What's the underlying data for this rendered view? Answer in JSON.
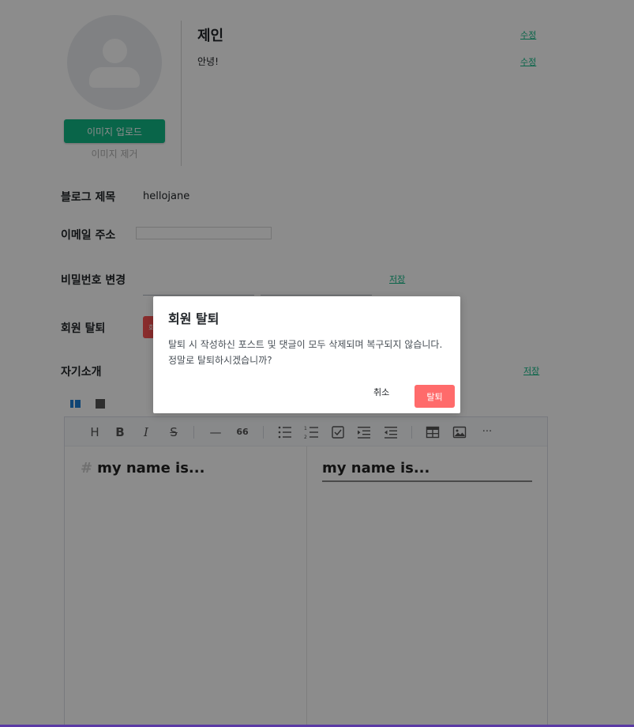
{
  "profile": {
    "name": "제인",
    "description": "안녕!",
    "edit_name_label": "수정",
    "edit_desc_label": "수정",
    "upload_label": "이미지 업로드",
    "remove_label": "이미지 제거"
  },
  "settings": {
    "blog_title_label": "블로그 제목",
    "blog_title_value": "hellojane",
    "email_label": "이메일 주소",
    "email_value": "",
    "password_label": "비밀번호 변경",
    "password_save_label": "저장",
    "withdraw_label": "회원 탈퇴",
    "withdraw_button_label": "회",
    "bio_label": "자기소개",
    "bio_save_label": "저장"
  },
  "editor": {
    "markdown_line_hash": "#",
    "markdown_line_text": "my name is...",
    "preview_heading": "my name is...",
    "toolbar": {
      "heading": "H",
      "bold": "B",
      "italic": "I",
      "strike": "S",
      "hr": "—",
      "quote": "66",
      "more": "···"
    }
  },
  "modal": {
    "title": "회원 탈퇴",
    "message": "탈퇴 시 작성하신 포스트 및 댓글이 모두 삭제되며 복구되지 않습니다. 정말로 탈퇴하시겠습니까?",
    "cancel_label": "취소",
    "confirm_label": "탈퇴"
  },
  "colors": {
    "accent": "#12b886",
    "danger": "#ff6b6b",
    "bottom_bar": "#5b3aa5"
  }
}
